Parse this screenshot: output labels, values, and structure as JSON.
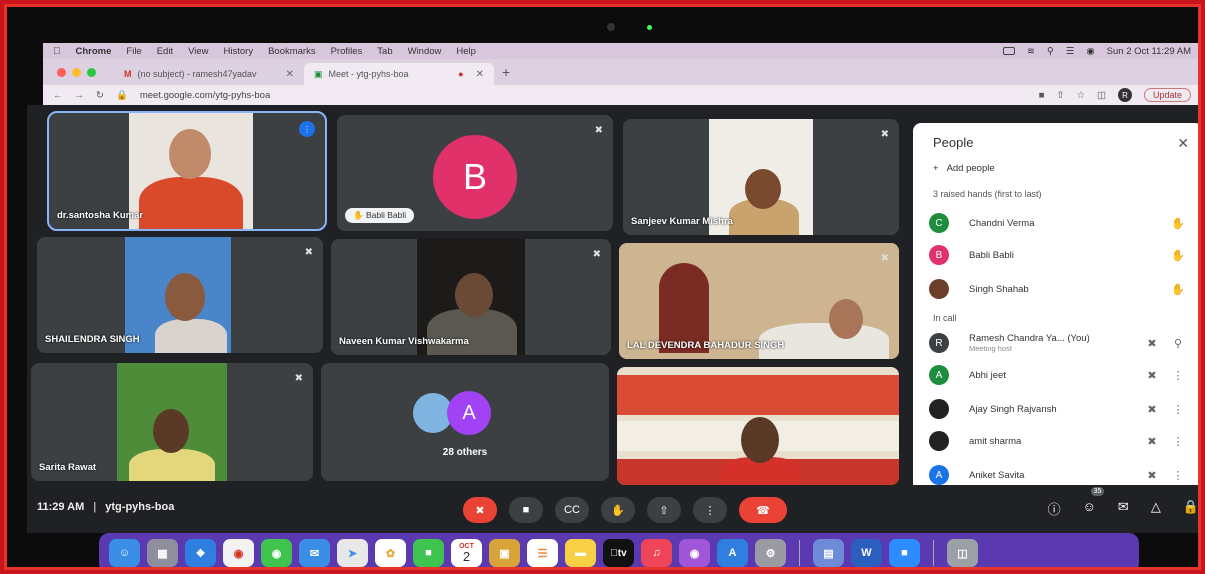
{
  "menubar": {
    "app": "Chrome",
    "items": [
      "File",
      "Edit",
      "View",
      "History",
      "Bookmarks",
      "Profiles",
      "Tab",
      "Window",
      "Help"
    ],
    "datetime": "Sun 2 Oct  11:29 AM"
  },
  "tabs": [
    {
      "label": "(no subject) - ramesh47yadav",
      "icon": "gmail-icon"
    },
    {
      "label": "Meet - ytg-pyhs-boa",
      "icon": "meet-icon"
    }
  ],
  "address": {
    "url": "meet.google.com/ytg-pyhs-boa",
    "update_label": "Update",
    "profile_initial": "R"
  },
  "tiles": [
    {
      "name": "dr.santosha Kumar"
    },
    {
      "name": "Babli Babli",
      "initial": "B"
    },
    {
      "name": "Sanjeev Kumar Mishra"
    },
    {
      "name": "SHAILENDRA SINGH"
    },
    {
      "name": "Naveen Kumar Vishwakarma"
    },
    {
      "name": "LAL DEVENDRA BAHADUR SINGH"
    },
    {
      "name": "Sarita Rawat"
    },
    {
      "name": "28 others",
      "initial": "A"
    },
    {
      "name": ""
    }
  ],
  "people": {
    "title": "People",
    "add_label": "Add people",
    "raised_label": "3 raised hands (first to last)",
    "raised": [
      {
        "name": "Chandni Verma",
        "initial": "C",
        "color": "#1e8e3e"
      },
      {
        "name": "Babli Babli",
        "initial": "B",
        "color": "#e0316a"
      },
      {
        "name": "Singh Shahab",
        "initial": "",
        "color": "#6b3e2a"
      }
    ],
    "incall_label": "In call",
    "incall": [
      {
        "name": "Ramesh Chandra Ya... (You)",
        "sub": "Meeting host",
        "initial": "R",
        "color": "#3c4043"
      },
      {
        "name": "Abhi jeet",
        "initial": "A",
        "color": "#1e8e3e"
      },
      {
        "name": "Ajay Singh Rajvansh",
        "initial": "",
        "color": "#222222"
      },
      {
        "name": "amit sharma",
        "initial": "",
        "color": "#222222"
      },
      {
        "name": "Aniket Savita",
        "initial": "A",
        "color": "#1a73e8"
      }
    ]
  },
  "bottom": {
    "time": "11:29 AM",
    "separator": "|",
    "code": "ytg-pyhs-boa",
    "participants_count": "35"
  },
  "dock": {
    "calendar_month": "OCT",
    "calendar_day": "2",
    "tv_label": "tv"
  }
}
